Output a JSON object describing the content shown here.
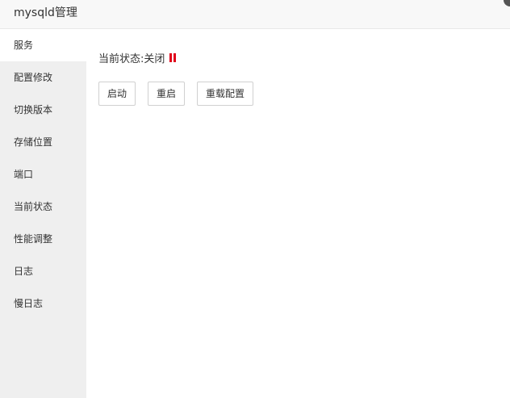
{
  "window": {
    "title": "mysqld管理"
  },
  "sidebar": {
    "items": [
      {
        "label": "服务"
      },
      {
        "label": "配置修改"
      },
      {
        "label": "切换版本"
      },
      {
        "label": "存储位置"
      },
      {
        "label": "端口"
      },
      {
        "label": "当前状态"
      },
      {
        "label": "性能调整"
      },
      {
        "label": "日志"
      },
      {
        "label": "慢日志"
      }
    ],
    "active_index": 0
  },
  "service": {
    "status_label": "当前状态: ",
    "status_value": "关闭",
    "status_icon": "pause-icon",
    "status_color": "#e0001a",
    "buttons": {
      "start": "启动",
      "restart": "重启",
      "reload": "重载配置"
    }
  }
}
